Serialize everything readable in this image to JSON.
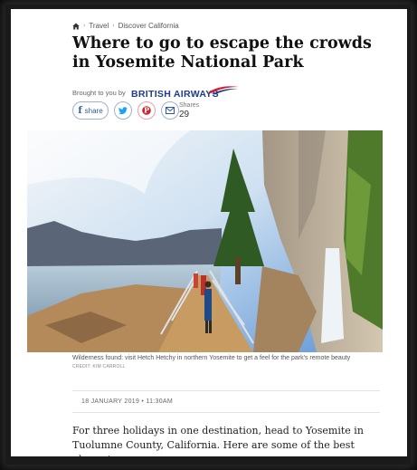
{
  "breadcrumb": {
    "items": [
      "Travel",
      "Discover California"
    ]
  },
  "article": {
    "title": "Where to go to escape the crowds in Yosemite National Park",
    "sponsor_prefix": "Brought to you by",
    "sponsor_name": "BRITISH AIRWAYS",
    "share_label": "share",
    "shares_label": "Shares",
    "shares_count": "29",
    "image_caption": "Wilderness found: visit Hetch Hetchy in northern Yosemite to get a feel for the park's remote beauty",
    "image_credit": "CREDIT: KIM CARROLL",
    "date": "18 JANUARY 2019 • 11:30AM",
    "lede": "For three holidays in one destination, head to Yosemite in Tuolumne County, California. Here are some of the best places to go"
  },
  "colors": {
    "facebook": "#2d5aa0",
    "twitter": "#1da1f2",
    "pinterest": "#c8232c",
    "ba_blue": "#1d3b8f",
    "ba_red": "#d31f2f"
  },
  "icons": [
    "home-icon",
    "facebook-icon",
    "twitter-icon",
    "pinterest-icon",
    "email-icon",
    "ba-swoosh-icon"
  ]
}
